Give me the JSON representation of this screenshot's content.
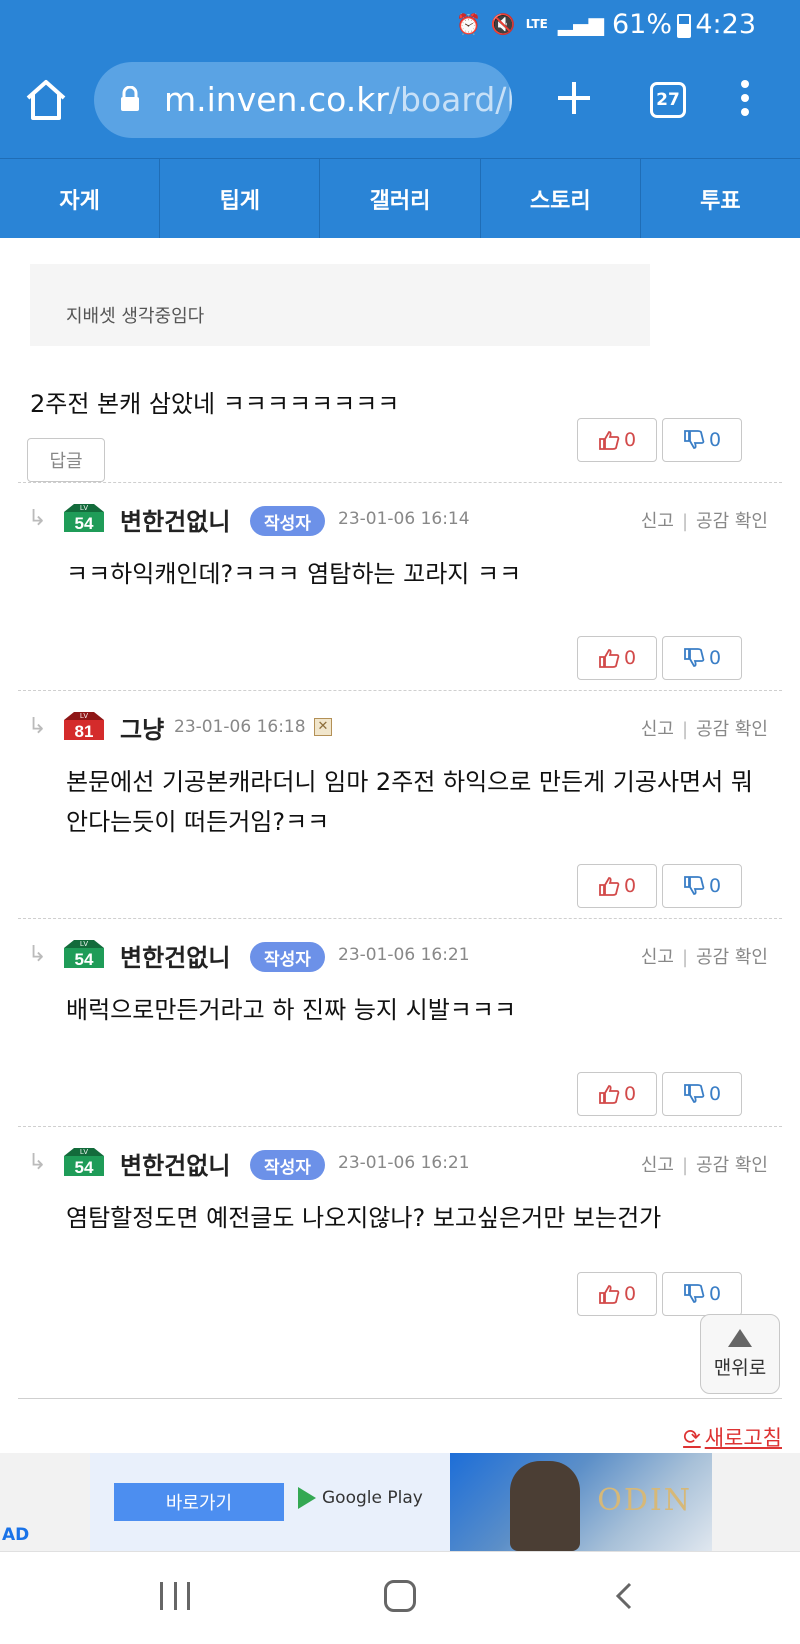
{
  "status": {
    "battery": "61%",
    "time": "4:23",
    "network": "LTE"
  },
  "browser": {
    "url_host": "m.inven.co.kr",
    "url_path": "/board/l",
    "tab_count": "27"
  },
  "site_nav": [
    "자게",
    "팁게",
    "갤러리",
    "스토리",
    "투표"
  ],
  "post": {
    "quoted_image_text": "지배셋 생각중임다",
    "text": "2주전 본캐 삼았네 ㅋㅋㅋㅋㅋㅋㅋㅋ",
    "reply_label": "답글",
    "likes": "0",
    "dislikes": "0"
  },
  "comments": [
    {
      "level": "54",
      "nick": "변한건없니",
      "badge": "작성자",
      "date": "23-01-06 16:14",
      "text": "ㅋㅋ하익캐인데?ㅋㅋㅋ 염탐하는 꼬라지 ㅋㅋ",
      "likes": "0",
      "dislikes": "0"
    },
    {
      "level": "81",
      "nick": "그냥",
      "badge": "",
      "date": "23-01-06 16:18",
      "text": "본문에선 기공본캐라더니 임마 2주전 하익으로 만든게 기공사면서 뭐 안다는듯이 떠든거임?ㅋㅋ",
      "likes": "0",
      "dislikes": "0"
    },
    {
      "level": "54",
      "nick": "변한건없니",
      "badge": "작성자",
      "date": "23-01-06 16:21",
      "text": "배럭으로만든거라고 하 진짜 능지 시발ㅋㅋㅋ",
      "likes": "0",
      "dislikes": "0"
    },
    {
      "level": "54",
      "nick": "변한건없니",
      "badge": "작성자",
      "date": "23-01-06 16:21",
      "text": "염탐할정도면 예전글도 나오지않나? 보고싶은거만 보는건가",
      "likes": "0",
      "dislikes": "0"
    }
  ],
  "comment_tools": {
    "report": "신고",
    "empathy": "공감 확인"
  },
  "top_button": "맨위로",
  "refresh": "새로고침",
  "ad": {
    "button": "바로가기",
    "store": "Google Play",
    "label": "AD",
    "logo": "ODIN"
  },
  "colors": {
    "brand_blue": "#2a84d6",
    "like_red": "#d24a4a",
    "dislike_blue": "#3a7ec6",
    "author_badge": "#6c91e8"
  }
}
